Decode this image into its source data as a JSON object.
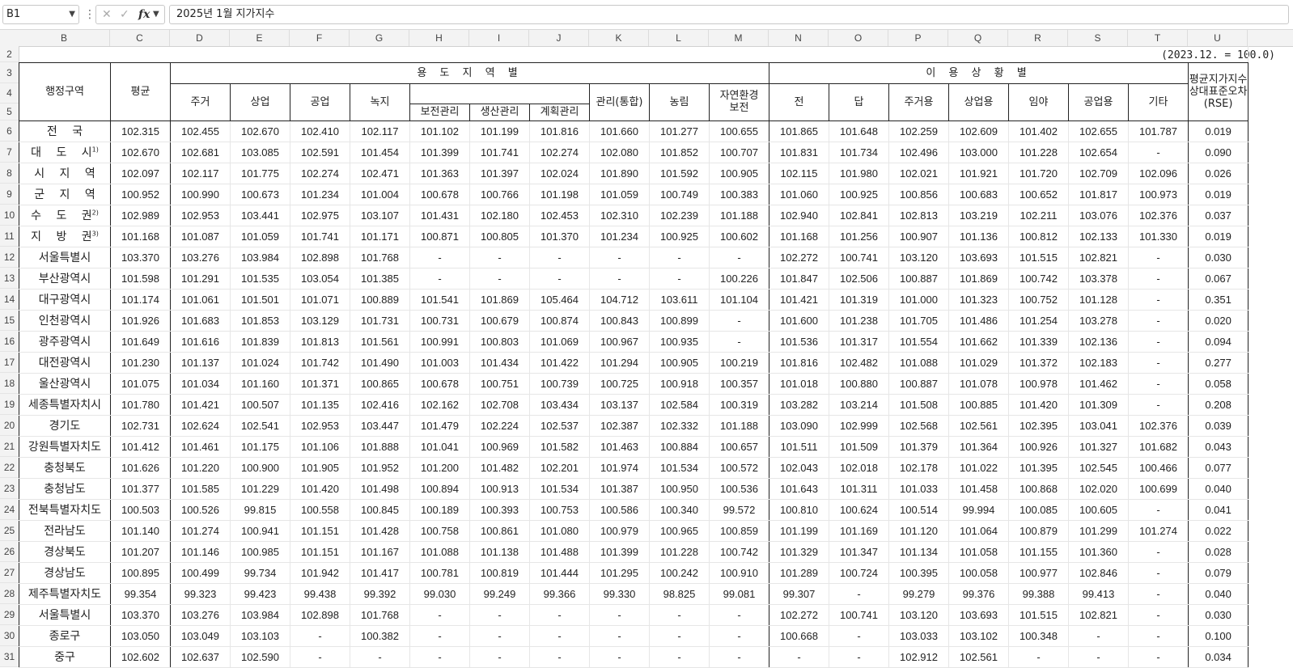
{
  "formula_bar": {
    "name_box": "B1",
    "fx_label": "fx",
    "cancel_icon": "✕",
    "confirm_icon": "✓",
    "formula": "2025년 1월 지가지수"
  },
  "column_headers": [
    "B",
    "C",
    "D",
    "E",
    "F",
    "G",
    "H",
    "I",
    "J",
    "K",
    "L",
    "M",
    "N",
    "O",
    "P",
    "Q",
    "R",
    "S",
    "T",
    "U"
  ],
  "row_headers": [
    "2",
    "3",
    "4",
    "5",
    "6",
    "7",
    "8",
    "9",
    "10",
    "11",
    "12",
    "13",
    "14",
    "15",
    "16",
    "17",
    "18",
    "19",
    "20",
    "21",
    "22",
    "23",
    "24",
    "25",
    "26",
    "27",
    "28",
    "29",
    "30",
    "31"
  ],
  "unit_note": "(2023.12. = 100.0)",
  "header": {
    "region": "행정구역",
    "average": "평균",
    "zone_group": "용 도 지 역 별",
    "use_group": "이 용 상 황 별",
    "rse": [
      "평균지가지수",
      "상대표준오차",
      "(RSE)"
    ],
    "zone_cols": [
      "주거",
      "상업",
      "공업",
      "녹지"
    ],
    "mgmt": [
      "보전관리",
      "생산관리",
      "계획관리"
    ],
    "mgmt_integrated": "관리(통합)",
    "forest": "농림",
    "nature": [
      "자연환경",
      "보전"
    ],
    "use_cols": [
      "전",
      "답",
      "주거용",
      "상업용",
      "임야",
      "공업용",
      "기타"
    ]
  },
  "rows": [
    {
      "region": "전 국",
      "sup": "",
      "values": [
        "102.315",
        "102.455",
        "102.670",
        "102.410",
        "102.117",
        "101.102",
        "101.199",
        "101.816",
        "101.660",
        "101.277",
        "100.655",
        "101.865",
        "101.648",
        "102.259",
        "102.609",
        "101.402",
        "102.655",
        "101.787",
        "0.019"
      ]
    },
    {
      "region": "대 도 시",
      "sup": "1)",
      "values": [
        "102.670",
        "102.681",
        "103.085",
        "102.591",
        "101.454",
        "101.399",
        "101.741",
        "102.274",
        "102.080",
        "101.852",
        "100.707",
        "101.831",
        "101.734",
        "102.496",
        "103.000",
        "101.228",
        "102.654",
        "-",
        "0.090"
      ]
    },
    {
      "region": "시 지 역",
      "sup": "",
      "values": [
        "102.097",
        "102.117",
        "101.775",
        "102.274",
        "102.471",
        "101.363",
        "101.397",
        "102.024",
        "101.890",
        "101.592",
        "100.905",
        "102.115",
        "101.980",
        "102.021",
        "101.921",
        "101.720",
        "102.709",
        "102.096",
        "0.026"
      ]
    },
    {
      "region": "군 지 역",
      "sup": "",
      "values": [
        "100.952",
        "100.990",
        "100.673",
        "101.234",
        "101.004",
        "100.678",
        "100.766",
        "101.198",
        "101.059",
        "100.749",
        "100.383",
        "101.060",
        "100.925",
        "100.856",
        "100.683",
        "100.652",
        "101.817",
        "100.973",
        "0.019"
      ]
    },
    {
      "region": "수 도 권",
      "sup": "2)",
      "values": [
        "102.989",
        "102.953",
        "103.441",
        "102.975",
        "103.107",
        "101.431",
        "102.180",
        "102.453",
        "102.310",
        "102.239",
        "101.188",
        "102.940",
        "102.841",
        "102.813",
        "103.219",
        "102.211",
        "103.076",
        "102.376",
        "0.037"
      ]
    },
    {
      "region": "지 방 권",
      "sup": "3)",
      "values": [
        "101.168",
        "101.087",
        "101.059",
        "101.741",
        "101.171",
        "100.871",
        "100.805",
        "101.370",
        "101.234",
        "100.925",
        "100.602",
        "101.168",
        "101.256",
        "100.907",
        "101.136",
        "100.812",
        "102.133",
        "101.330",
        "0.019"
      ]
    },
    {
      "region": "서울특별시",
      "sup": "",
      "values": [
        "103.370",
        "103.276",
        "103.984",
        "102.898",
        "101.768",
        "-",
        "-",
        "-",
        "-",
        "-",
        "-",
        "102.272",
        "100.741",
        "103.120",
        "103.693",
        "101.515",
        "102.821",
        "-",
        "0.030"
      ]
    },
    {
      "region": "부산광역시",
      "sup": "",
      "values": [
        "101.598",
        "101.291",
        "101.535",
        "103.054",
        "101.385",
        "-",
        "-",
        "-",
        "-",
        "-",
        "100.226",
        "101.847",
        "102.506",
        "100.887",
        "101.869",
        "100.742",
        "103.378",
        "-",
        "0.067"
      ]
    },
    {
      "region": "대구광역시",
      "sup": "",
      "values": [
        "101.174",
        "101.061",
        "101.501",
        "101.071",
        "100.889",
        "101.541",
        "101.869",
        "105.464",
        "104.712",
        "103.611",
        "101.104",
        "101.421",
        "101.319",
        "101.000",
        "101.323",
        "100.752",
        "101.128",
        "-",
        "0.351"
      ]
    },
    {
      "region": "인천광역시",
      "sup": "",
      "values": [
        "101.926",
        "101.683",
        "101.853",
        "103.129",
        "101.731",
        "100.731",
        "100.679",
        "100.874",
        "100.843",
        "100.899",
        "-",
        "101.600",
        "101.238",
        "101.705",
        "101.486",
        "101.254",
        "103.278",
        "-",
        "0.020"
      ]
    },
    {
      "region": "광주광역시",
      "sup": "",
      "values": [
        "101.649",
        "101.616",
        "101.839",
        "101.813",
        "101.561",
        "100.991",
        "100.803",
        "101.069",
        "100.967",
        "100.935",
        "-",
        "101.536",
        "101.317",
        "101.554",
        "101.662",
        "101.339",
        "102.136",
        "-",
        "0.094"
      ]
    },
    {
      "region": "대전광역시",
      "sup": "",
      "values": [
        "101.230",
        "101.137",
        "101.024",
        "101.742",
        "101.490",
        "101.003",
        "101.434",
        "101.422",
        "101.294",
        "100.905",
        "100.219",
        "101.816",
        "102.482",
        "101.088",
        "101.029",
        "101.372",
        "102.183",
        "-",
        "0.277"
      ]
    },
    {
      "region": "울산광역시",
      "sup": "",
      "values": [
        "101.075",
        "101.034",
        "101.160",
        "101.371",
        "100.865",
        "100.678",
        "100.751",
        "100.739",
        "100.725",
        "100.918",
        "100.357",
        "101.018",
        "100.880",
        "100.887",
        "101.078",
        "100.978",
        "101.462",
        "-",
        "0.058"
      ]
    },
    {
      "region": "세종특별자치시",
      "sup": "",
      "values": [
        "101.780",
        "101.421",
        "100.507",
        "101.135",
        "102.416",
        "102.162",
        "102.708",
        "103.434",
        "103.137",
        "102.584",
        "100.319",
        "103.282",
        "103.214",
        "101.508",
        "100.885",
        "101.420",
        "101.309",
        "-",
        "0.208"
      ]
    },
    {
      "region": "경기도",
      "sup": "",
      "values": [
        "102.731",
        "102.624",
        "102.541",
        "102.953",
        "103.447",
        "101.479",
        "102.224",
        "102.537",
        "102.387",
        "102.332",
        "101.188",
        "103.090",
        "102.999",
        "102.568",
        "102.561",
        "102.395",
        "103.041",
        "102.376",
        "0.039"
      ]
    },
    {
      "region": "강원특별자치도",
      "sup": "",
      "values": [
        "101.412",
        "101.461",
        "101.175",
        "101.106",
        "101.888",
        "101.041",
        "100.969",
        "101.582",
        "101.463",
        "100.884",
        "100.657",
        "101.511",
        "101.509",
        "101.379",
        "101.364",
        "100.926",
        "101.327",
        "101.682",
        "0.043"
      ]
    },
    {
      "region": "충청북도",
      "sup": "",
      "values": [
        "101.626",
        "101.220",
        "100.900",
        "101.905",
        "101.952",
        "101.200",
        "101.482",
        "102.201",
        "101.974",
        "101.534",
        "100.572",
        "102.043",
        "102.018",
        "102.178",
        "101.022",
        "101.395",
        "102.545",
        "100.466",
        "0.077"
      ]
    },
    {
      "region": "충청남도",
      "sup": "",
      "values": [
        "101.377",
        "101.585",
        "101.229",
        "101.420",
        "101.498",
        "100.894",
        "100.913",
        "101.534",
        "101.387",
        "100.950",
        "100.536",
        "101.643",
        "101.311",
        "101.033",
        "101.458",
        "100.868",
        "102.020",
        "100.699",
        "0.040"
      ]
    },
    {
      "region": "전북특별자치도",
      "sup": "",
      "values": [
        "100.503",
        "100.526",
        "99.815",
        "100.558",
        "100.845",
        "100.189",
        "100.393",
        "100.753",
        "100.586",
        "100.340",
        "99.572",
        "100.810",
        "100.624",
        "100.514",
        "99.994",
        "100.085",
        "100.605",
        "-",
        "0.041"
      ]
    },
    {
      "region": "전라남도",
      "sup": "",
      "values": [
        "101.140",
        "101.274",
        "100.941",
        "101.151",
        "101.428",
        "100.758",
        "100.861",
        "101.080",
        "100.979",
        "100.965",
        "100.859",
        "101.199",
        "101.169",
        "101.120",
        "101.064",
        "100.879",
        "101.299",
        "101.274",
        "0.022"
      ]
    },
    {
      "region": "경상북도",
      "sup": "",
      "values": [
        "101.207",
        "101.146",
        "100.985",
        "101.151",
        "101.167",
        "101.088",
        "101.138",
        "101.488",
        "101.399",
        "101.228",
        "100.742",
        "101.329",
        "101.347",
        "101.134",
        "101.058",
        "101.155",
        "101.360",
        "-",
        "0.028"
      ]
    },
    {
      "region": "경상남도",
      "sup": "",
      "values": [
        "100.895",
        "100.499",
        "99.734",
        "101.942",
        "101.417",
        "100.781",
        "100.819",
        "101.444",
        "101.295",
        "100.242",
        "100.910",
        "101.289",
        "100.724",
        "100.395",
        "100.058",
        "100.977",
        "102.846",
        "-",
        "0.079"
      ]
    },
    {
      "region": "제주특별자치도",
      "sup": "",
      "values": [
        "99.354",
        "99.323",
        "99.423",
        "99.438",
        "99.392",
        "99.030",
        "99.249",
        "99.366",
        "99.330",
        "98.825",
        "99.081",
        "99.307",
        "-",
        "99.279",
        "99.376",
        "99.388",
        "99.413",
        "-",
        "0.040"
      ]
    },
    {
      "region": "서울특별시",
      "sup": "",
      "values": [
        "103.370",
        "103.276",
        "103.984",
        "102.898",
        "101.768",
        "-",
        "-",
        "-",
        "-",
        "-",
        "-",
        "102.272",
        "100.741",
        "103.120",
        "103.693",
        "101.515",
        "102.821",
        "-",
        "0.030"
      ]
    },
    {
      "region": "종로구",
      "sup": "",
      "values": [
        "103.050",
        "103.049",
        "103.103",
        "-",
        "100.382",
        "-",
        "-",
        "-",
        "-",
        "-",
        "-",
        "100.668",
        "-",
        "103.033",
        "103.102",
        "100.348",
        "-",
        "-",
        "0.100"
      ]
    },
    {
      "region": "중구",
      "sup": "",
      "values": [
        "102.602",
        "102.637",
        "102.590",
        "-",
        "-",
        "-",
        "-",
        "-",
        "-",
        "-",
        "-",
        "-",
        "-",
        "102.912",
        "102.561",
        "-",
        "-",
        "-",
        "0.034"
      ]
    }
  ]
}
